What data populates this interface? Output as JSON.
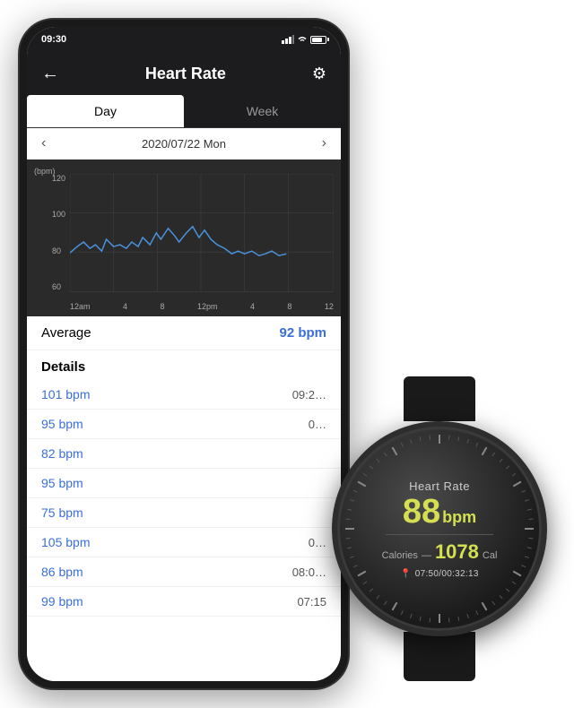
{
  "statusBar": {
    "time": "09:30",
    "battery": "70"
  },
  "appBar": {
    "title": "Heart Rate",
    "backArrow": "←",
    "gearIcon": "⚙"
  },
  "tabs": [
    {
      "label": "Day",
      "active": true
    },
    {
      "label": "Week",
      "active": false
    }
  ],
  "dateNav": {
    "prevArrow": "‹",
    "nextArrow": "›",
    "label": "2020/07/22 Mon"
  },
  "chart": {
    "yLabel": "(bpm)",
    "yTicks": [
      "120",
      "100",
      "80",
      "60"
    ],
    "xTicks": [
      "12am",
      "4",
      "8",
      "12pm",
      "4",
      "8",
      "12"
    ]
  },
  "average": {
    "label": "Average",
    "value": "92 bpm"
  },
  "details": {
    "title": "Details",
    "rows": [
      {
        "bpm": "101 bpm",
        "time": "09:2"
      },
      {
        "bpm": "95 bpm",
        "time": "0"
      },
      {
        "bpm": "82 bpm",
        "time": ""
      },
      {
        "bpm": "95 bpm",
        "time": ""
      },
      {
        "bpm": "75 bpm",
        "time": ""
      },
      {
        "bpm": "105 bpm",
        "time": "0"
      },
      {
        "bpm": "86 bpm",
        "time": "08:0"
      },
      {
        "bpm": "99 bpm",
        "time": "07:15"
      }
    ]
  },
  "watch": {
    "title": "Heart Rate",
    "bpmValue": "88",
    "bpmUnit": "bpm",
    "caloriesLabel": "Calories",
    "caloriesDash": "—",
    "caloriesValue": "1078",
    "caloriesUnit": "Cal",
    "coords": "07:50/00:32:13"
  }
}
